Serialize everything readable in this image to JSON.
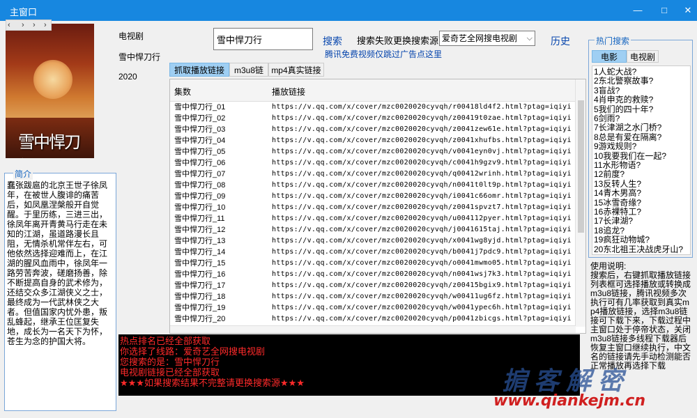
{
  "window": {
    "title": "主窗口",
    "minimize": "—",
    "maximize": "□",
    "close": "✕"
  },
  "nav": {
    "items": [
      "‹",
      "›",
      "›",
      "›"
    ]
  },
  "drama": {
    "category": "电视剧",
    "name": "雪中悍刀行",
    "year": "2020",
    "poster_text": "雪中悍刀行"
  },
  "intro": {
    "title": "简介",
    "text": "蠢张跋扈的北京王世子徐凤年，在被世人腹诽的痛苦后，如凤凰涅槃般开自觉醒。于里历练，三进三出，徐凤年离开青黄马行走在未知的江湖，虽道路漫长且阻，无情杀机常伴左右，可他依然选择迎难而上，在江湖的腥风血雨中，徐凤年一路劳苦奔波，磋磨扬善，除不断提高自身的武术修为，还结交众多江湖侠义之士，最终成为一代武林侠之大者。但值国家内忧外患，叛乱蜂起，继承王位匡复失地，成长为一名天下为怀，苍生为念的护国大将。"
  },
  "search": {
    "value": "雪中悍刀行",
    "button": "搜索",
    "source_label": "搜索失败更换搜索源:",
    "source_value": "爱奇艺全网搜电视剧",
    "history": "历史",
    "tencent_link": "腾讯免费视频仅跳过广告点这里"
  },
  "tabs": [
    "抓取播放链接",
    "m3u8链接",
    "mp4真实链接"
  ],
  "table": {
    "headers": [
      "集数",
      "播放链接"
    ],
    "rows": [
      [
        "雪中悍刀行_01",
        "https://v.qq.com/x/cover/mzc0020020cyvqh/r00418ld4f2.html?ptag=iqiyi"
      ],
      [
        "雪中悍刀行_02",
        "https://v.qq.com/x/cover/mzc0020020cyvqh/z00419t0zae.html?ptag=iqiyi"
      ],
      [
        "雪中悍刀行_03",
        "https://v.qq.com/x/cover/mzc0020020cyvqh/z0041zew61e.html?ptag=iqiyi"
      ],
      [
        "雪中悍刀行_04",
        "https://v.qq.com/x/cover/mzc0020020cyvqh/z0041xhufbs.html?ptag=iqiyi"
      ],
      [
        "雪中悍刀行_05",
        "https://v.qq.com/x/cover/mzc0020020cyvqh/v0041eyn0vj.html?ptag=iqiyi"
      ],
      [
        "雪中悍刀行_06",
        "https://v.qq.com/x/cover/mzc0020020cyvqh/c0041h9gzv9.html?ptag=iqiyi"
      ],
      [
        "雪中悍刀行_07",
        "https://v.qq.com/x/cover/mzc0020020cyvqh/q00412wrinh.html?ptag=iqiyi"
      ],
      [
        "雪中悍刀行_08",
        "https://v.qq.com/x/cover/mzc0020020cyvqh/n0041t0lt9p.html?ptag=iqiyi"
      ],
      [
        "雪中悍刀行_09",
        "https://v.qq.com/x/cover/mzc0020020cyvqh/i0041c66omr.html?ptag=iqiyi"
      ],
      [
        "雪中悍刀行_10",
        "https://v.qq.com/x/cover/mzc0020020cyvqh/z0041spvzt7.html?ptag=iqiyi"
      ],
      [
        "雪中悍刀行_11",
        "https://v.qq.com/x/cover/mzc0020020cyvqh/u004112pyer.html?ptag=iqiyi"
      ],
      [
        "雪中悍刀行_12",
        "https://v.qq.com/x/cover/mzc0020020cyvqh/j0041615taj.html?ptag=iqiyi"
      ],
      [
        "雪中悍刀行_13",
        "https://v.qq.com/x/cover/mzc0020020cyvqh/x0041wg8yjd.html?ptag=iqiyi"
      ],
      [
        "雪中悍刀行_14",
        "https://v.qq.com/x/cover/mzc0020020cyvqh/b0041j7pdc9.html?ptag=iqiyi"
      ],
      [
        "雪中悍刀行_15",
        "https://v.qq.com/x/cover/mzc0020020cyvqh/o0041mwmo05.html?ptag=iqiyi"
      ],
      [
        "雪中悍刀行_16",
        "https://v.qq.com/x/cover/mzc0020020cyvqh/n0041wsj7k3.html?ptag=iqiyi"
      ],
      [
        "雪中悍刀行_17",
        "https://v.qq.com/x/cover/mzc0020020cyvqh/z00415bgix9.html?ptag=iqiyi"
      ],
      [
        "雪中悍刀行_18",
        "https://v.qq.com/x/cover/mzc0020020cyvqh/w00411ug6fz.html?ptag=iqiyi"
      ],
      [
        "雪中悍刀行_19",
        "https://v.qq.com/x/cover/mzc0020020cyvqh/w0041ypec6h.html?ptag=iqiyi"
      ],
      [
        "雪中悍刀行_20",
        "https://v.qq.com/x/cover/mzc0020020cyvqh/p0041zbicgs.html?ptag=iqiyi"
      ]
    ]
  },
  "log": [
    "热点排名已经全部获取",
    "你选择了线路：爱奇艺全网搜电视剧",
    "您搜索的是：雪中悍刀行",
    "电视剧链接已经全部获取",
    "★★★如果搜索结果不完整请更换搜索源★★★"
  ],
  "hot": {
    "title": "热门搜索",
    "tabs": [
      "电影",
      "电视剧"
    ],
    "items": [
      "1人蛇大战?",
      "2东北警察故事?",
      "3盲战?",
      "4肖申克的救赎?",
      "5我们的四十年?",
      "6剑雨?",
      "7长津湖之水门桥?",
      "8总是有爱在隔离?",
      "9游戏规则?",
      "10我要我们在一起?",
      "11水形物语?",
      "12前度?",
      "13反转人生?",
      "14青木男高?",
      "15冰雪奇缘?",
      "16赤裸特工?",
      "17长津湖?",
      "18追龙?",
      "19疯狂动物城?",
      "20东北祖王决战虎牙山?"
    ]
  },
  "usage": {
    "title": "使用说明:",
    "text": "搜索后，右键抓取播放链接列表框可选择播放或转换成m3u8链接，腾讯视频多次执行可有几率获取到真实mp4播放链接，选择m3u8链接可下载下来，下载过程中 主窗口处于停帝状态，关闭m3u8链接多线程下载器后恢复主窗口继续执行，中文名的链接请先手动检测能否正常播放再选择下载"
  },
  "watermark": {
    "text": "掮客解密",
    "url": "www.qiankejm.cn"
  }
}
